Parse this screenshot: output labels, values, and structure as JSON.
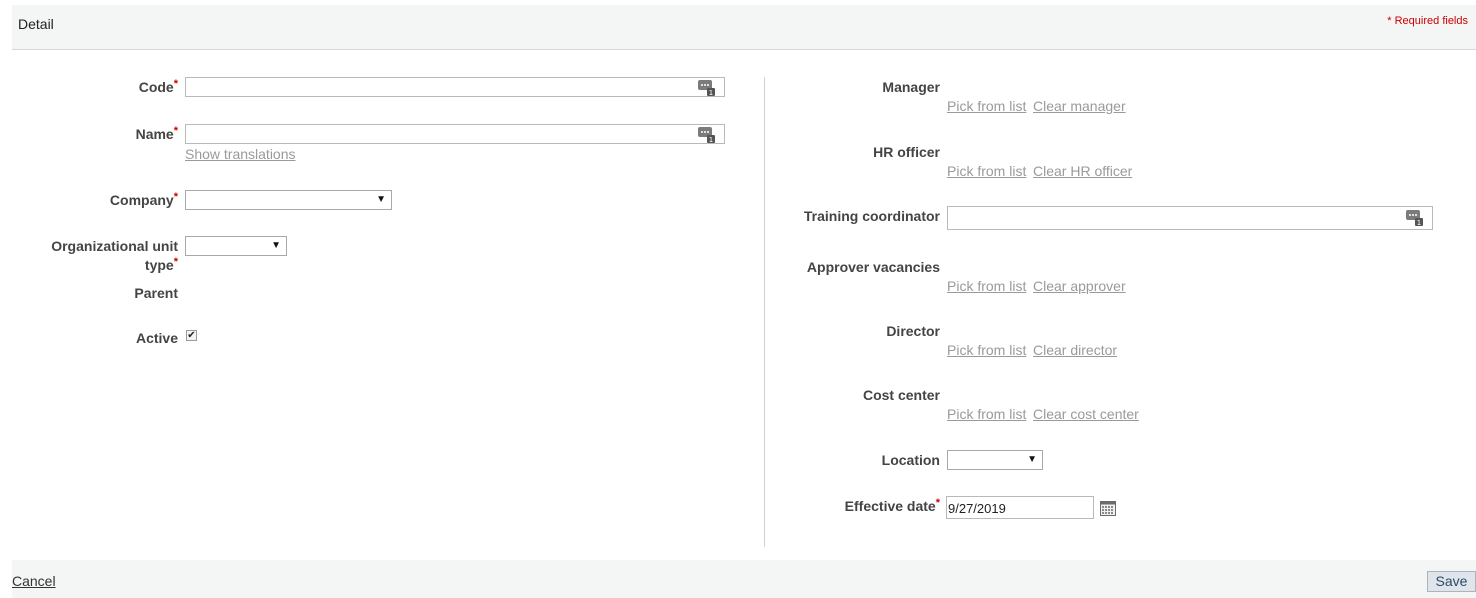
{
  "header": {
    "title": "Detail",
    "required_note": "* Required fields"
  },
  "left": {
    "code_label": "Code",
    "name_label": "Name",
    "show_translations": "Show translations",
    "company_label": "Company",
    "org_unit_type_label_line1": "Organizational unit",
    "org_unit_type_label_line2": "type",
    "parent_label": "Parent",
    "active_label": "Active",
    "active_checked": true
  },
  "right": {
    "manager_label": "Manager",
    "hr_officer_label": "HR officer",
    "training_coordinator_label": "Training coordinator",
    "approver_vacancies_label": "Approver vacancies",
    "director_label": "Director",
    "cost_center_label": "Cost center",
    "location_label": "Location",
    "effective_date_label": "Effective date",
    "effective_date_value": "9/27/2019",
    "pick_from_list": "Pick from list",
    "clear_manager": "Clear manager",
    "clear_hr_officer": "Clear HR officer",
    "clear_approver": "Clear approver",
    "clear_director": "Clear director",
    "clear_cost_center": "Clear cost center"
  },
  "required_star": "*",
  "select_arrow": "▼",
  "icons": {
    "translation": "translation-icon",
    "calendar": "calendar-icon",
    "checkmark": "checkmark-icon"
  },
  "footer": {
    "cancel": "Cancel",
    "save": "Save"
  }
}
